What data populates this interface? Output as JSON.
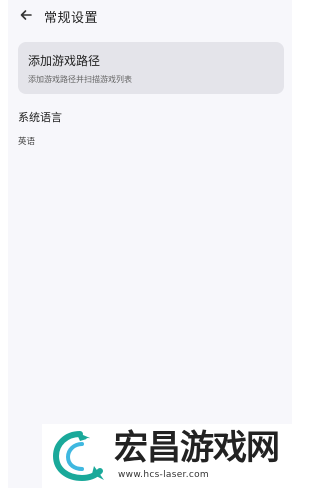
{
  "header": {
    "back_icon": "arrow-left-icon",
    "title": "常规设置"
  },
  "game_path_card": {
    "title": "添加游戏路径",
    "subtitle": "添加游戏路径并扫描游戏列表"
  },
  "language_section": {
    "label": "系统语言",
    "value": "英语"
  },
  "watermark": {
    "logo_icon": "dragon-logo-icon",
    "brand": "宏昌游戏网",
    "url": "www.hcs-laser.com",
    "colors": {
      "dragon_primary": "#1aa99a",
      "dragon_secondary": "#3fb8e0"
    }
  }
}
